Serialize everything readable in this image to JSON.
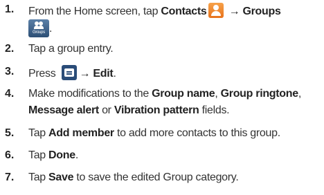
{
  "steps": [
    {
      "number": "1.",
      "line1": {
        "pre": "From the Home screen, tap ",
        "contacts": "Contacts",
        "arrow": "→",
        "groups": "Groups"
      },
      "icon_contacts": "contacts-icon",
      "icon_groups": "groups-icon",
      "groups_icon_caption": "Groups",
      "period": "."
    },
    {
      "number": "2.",
      "text": "Tap a group entry."
    },
    {
      "number": "3.",
      "pre": "Press ",
      "icon": "menu-icon",
      "arrow": "→",
      "bold": "Edit",
      "post": "."
    },
    {
      "number": "4.",
      "line1": {
        "pre": "Make modifications to the ",
        "b1": "Group name",
        "sep1": ", ",
        "b2": "Group ringtone",
        "sep2": ","
      },
      "line2": {
        "b3": "Message alert",
        "sep": " or ",
        "b4": "Vibration pattern",
        "post": " fields."
      }
    },
    {
      "number": "5.",
      "pre": "Tap ",
      "bold": "Add member",
      "post": " to add more contacts to this group."
    },
    {
      "number": "6.",
      "pre": "Tap ",
      "bold": "Done",
      "post": "."
    },
    {
      "number": "7.",
      "pre": "Tap ",
      "bold": "Save",
      "post": " to save the edited Group category."
    }
  ]
}
